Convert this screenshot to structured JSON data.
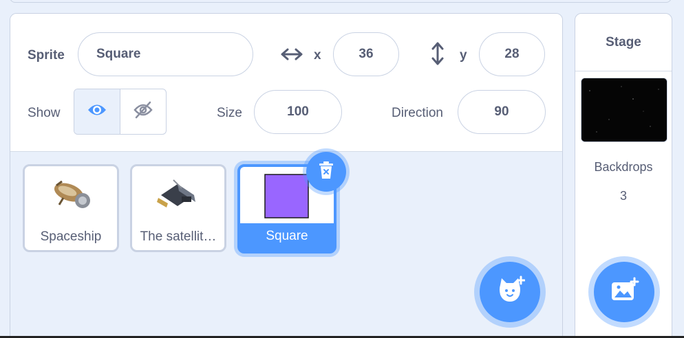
{
  "sprite_info": {
    "sprite_label": "Sprite",
    "sprite_name": "Square",
    "x_label": "x",
    "x_value": "36",
    "y_label": "y",
    "y_value": "28",
    "show_label": "Show",
    "size_label": "Size",
    "size_value": "100",
    "direction_label": "Direction",
    "direction_value": "90"
  },
  "sprites": [
    {
      "name": "Spaceship",
      "selected": false
    },
    {
      "name": "The satellit…",
      "selected": false
    },
    {
      "name": "Square",
      "selected": true,
      "thumb_color": "#9966ff"
    }
  ],
  "stage": {
    "title": "Stage",
    "backdrops_label": "Backdrops",
    "backdrops_count": "3"
  },
  "colors": {
    "accent": "#4c97ff",
    "text": "#575e75",
    "square_fill": "#9966ff"
  },
  "icons": {
    "x_arrow": "horizontal-arrows-icon",
    "y_arrow": "vertical-arrows-icon",
    "show": "eye-icon",
    "hide": "eye-slash-icon",
    "delete": "trash-icon",
    "add_sprite": "cat-plus-icon",
    "add_backdrop": "image-plus-icon"
  }
}
